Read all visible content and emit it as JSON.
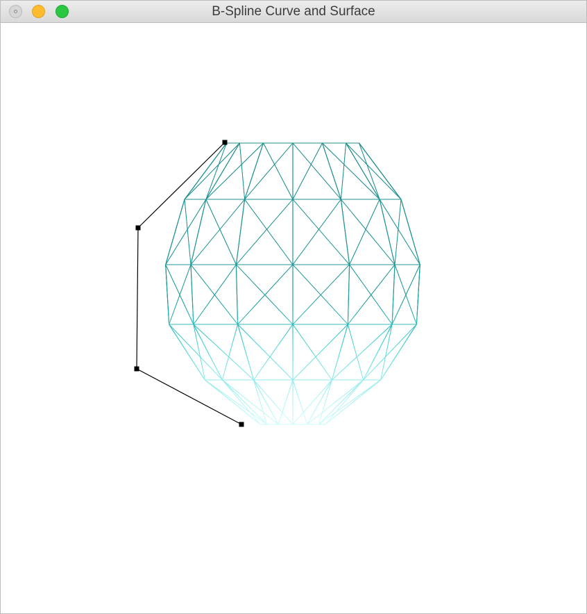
{
  "window": {
    "title": "B-Spline Curve and Surface"
  },
  "icons": {
    "close": "close-window-icon",
    "minimize": "minimize-window-icon",
    "zoom": "zoom-window-icon"
  },
  "colors": {
    "surface_dark": "#1f8c8c",
    "surface_light": "#66f2f2",
    "control_polygon": "#000000",
    "control_point": "#000000"
  }
}
